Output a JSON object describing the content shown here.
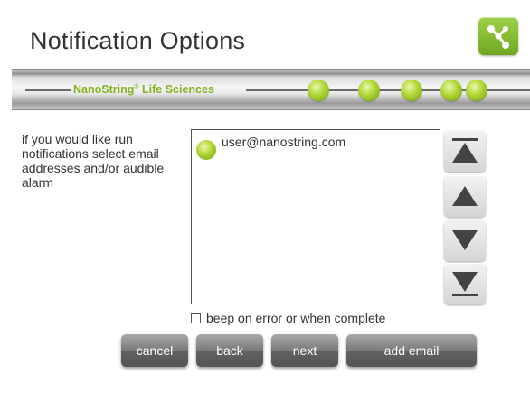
{
  "title": "Notification Options",
  "icons": {
    "app": "network-icon",
    "top": "scroll-top-icon",
    "up": "scroll-up-icon",
    "down": "scroll-down-icon",
    "bottom": "scroll-bottom-icon"
  },
  "banner": {
    "brand": "NanoString",
    "reg": "®",
    "suffix": " Life Sciences"
  },
  "instructions": "if you would like run notifications select email addresses and/or audible alarm",
  "emails": [
    "user@nanostring.com"
  ],
  "checkbox_label": "beep on error or when complete",
  "checkbox_checked": false,
  "buttons": {
    "cancel": "cancel",
    "back": "back",
    "next": "next",
    "add_email": "add email"
  },
  "colors": {
    "accent": "#86b21a",
    "button": "#6a6a6a"
  }
}
